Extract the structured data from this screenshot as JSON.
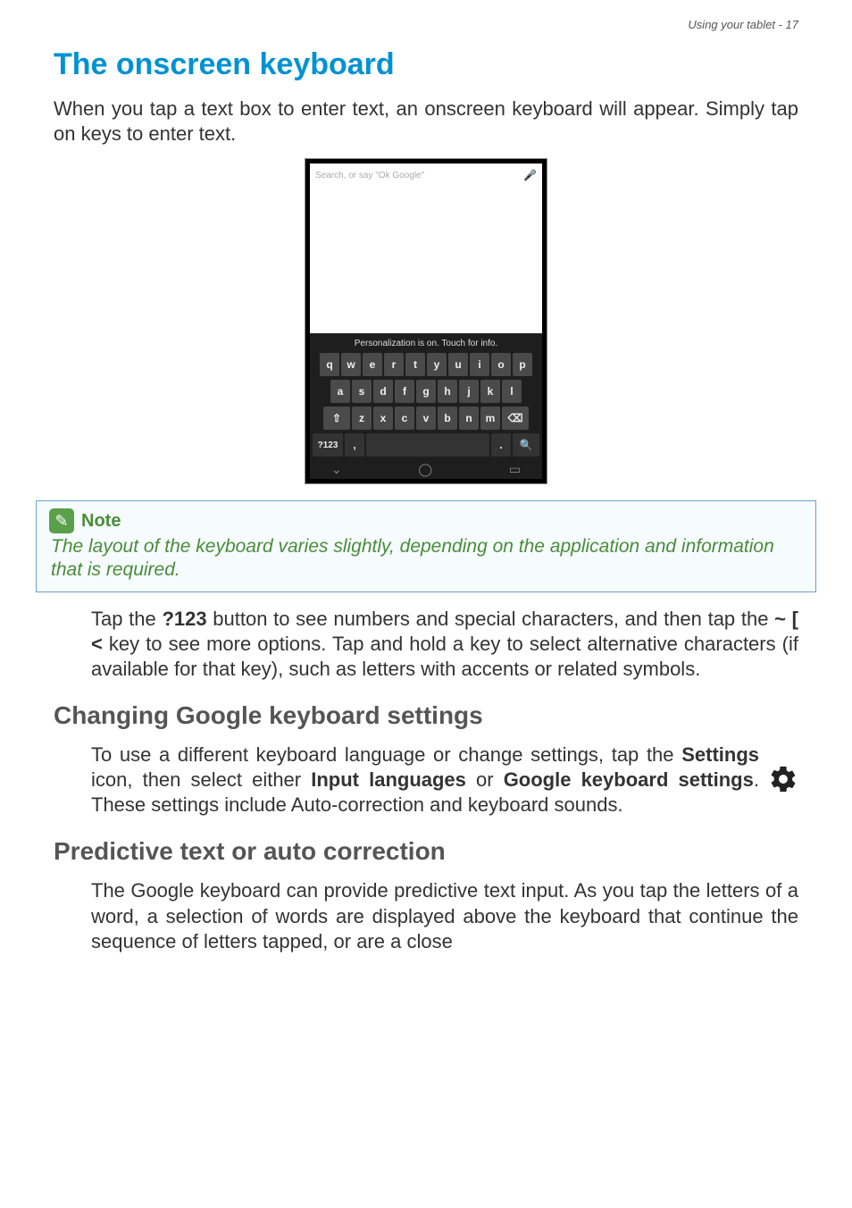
{
  "header": {
    "text": "Using your tablet - 17"
  },
  "title": "The onscreen keyboard",
  "intro": "When you tap a text box to enter text, an onscreen keyboard will appear. Simply tap on keys to enter text.",
  "phone": {
    "search_placeholder": "Search, or say \"Ok Google\"",
    "kbd_hint": "Personalization is on. Touch for info.",
    "row1": [
      "q",
      "w",
      "e",
      "r",
      "t",
      "y",
      "u",
      "i",
      "o",
      "p"
    ],
    "row2": [
      "a",
      "s",
      "d",
      "f",
      "g",
      "h",
      "j",
      "k",
      "l"
    ],
    "row3_shift": "⇧",
    "row3": [
      "z",
      "x",
      "c",
      "v",
      "b",
      "n",
      "m"
    ],
    "row3_del": "⌫",
    "row4_sym": "?123",
    "row4_comma": ",",
    "row4_period": ".",
    "row4_search": "🔍",
    "nav": {
      "back": "⌄",
      "home": "◯",
      "recent": "▭"
    }
  },
  "note": {
    "title": "Note",
    "body": "The layout of the keyboard varies slightly, depending on the application and information that is required."
  },
  "para_after_note": {
    "t1": "Tap the ",
    "b1": "?123",
    "t2": " button to see numbers and special characters, and then tap the ",
    "b2": "~ [ <",
    "t3": " key to see more options. Tap and hold a key to select alternative characters (if available for that key), such as letters with accents or related symbols."
  },
  "heading_settings": "Changing Google keyboard settings",
  "para_settings": {
    "t1": "To use a different keyboard language or change settings, tap the ",
    "b1": "Settings",
    "t2": " icon, then select either ",
    "b2": "Input languages",
    "t3": " or ",
    "b3": "Google keyboard settings",
    "t4": ". These settings include Auto-correction and keyboard sounds."
  },
  "heading_predictive": "Predictive text or auto correction",
  "para_predictive": "The Google keyboard can provide predictive text input. As you tap the letters of a word, a selection of words are displayed above the keyboard that continue the sequence of letters tapped, or are a close"
}
